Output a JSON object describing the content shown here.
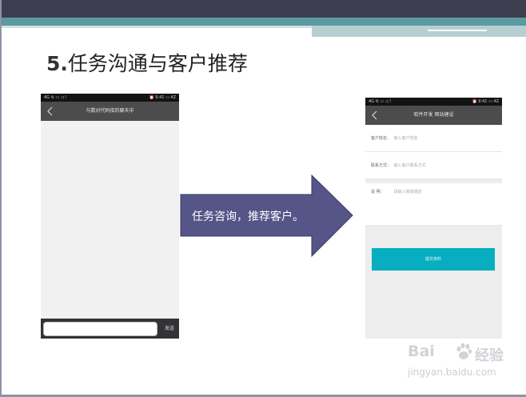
{
  "slide": {
    "title_number": "5.",
    "title_text": "任务沟通与客户推荐",
    "arrow_text": "任务咨询，推荐客户。"
  },
  "phone_left": {
    "status_left": "4G ⇅ ▭ ◁ !",
    "status_right": "⏰ 9:41 ▭ 4Z",
    "nav_title": "与数对代码接的聊天中",
    "send_label": "发送"
  },
  "phone_right": {
    "status_left": "4G ⇅ ▭ ◁ !",
    "status_right": "⏰ 9:41 ▭ 4Z",
    "nav_title": "软件开发 网站建设",
    "fields": [
      {
        "label": "客户姓名：",
        "placeholder": "输入客户姓名"
      },
      {
        "label": "联系方式：",
        "placeholder": "输入客户联系方式"
      },
      {
        "label": "说    明：",
        "placeholder": "请输入简单描述"
      }
    ],
    "submit_label": "提交资料"
  },
  "watermark": {
    "brand": "Bai",
    "brand_suffix": "经验",
    "url": "jingyan.baidu.com"
  },
  "colors": {
    "arrow_fill": "#555588",
    "header_dark": "#3c3e4f",
    "header_teal": "#5a9aa0",
    "submit_teal": "#06aebf"
  }
}
